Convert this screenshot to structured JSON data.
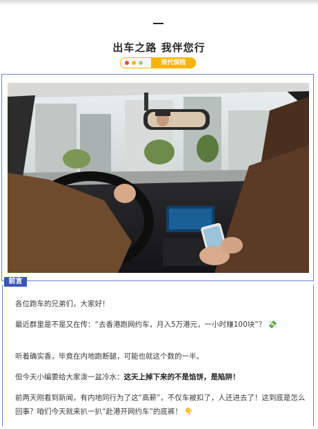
{
  "header": {
    "headline": "出车之路 我伴您行",
    "tag_label": "现代保险",
    "dot_colors": [
      "#e94b4b",
      "#f5b400",
      "#9acd85"
    ]
  },
  "intro": {
    "tag": "前言"
  },
  "article": {
    "p1": "各位跑车的兄弟们，大家好！",
    "p2": "最近群里是不是又在传：“去香港跑网约车，月入5万港元，一小时赚100块”？",
    "p2_emoji": "💸",
    "p3": "听着确实香，毕竟在内地跑断腿，可能也就这个数的一半。",
    "p4_plain": "但今天小编要给大家泼一盆冷水：",
    "p4_bold": "这天上掉下来的不是馅饼，是陷阱！",
    "p5": "前两天刚看到新闻，有内地同行为了这“高薪”，不仅车被扣了，人还进去了！这到底是怎么回事？咱们今天就来扒一扒“赴港开网约车”的底裤！",
    "p5_emoji": "👇"
  },
  "colors": {
    "accent_yellow": "#f7b500",
    "frame_blue": "#6b7fd0",
    "tag_blue": "#3a54b8"
  }
}
